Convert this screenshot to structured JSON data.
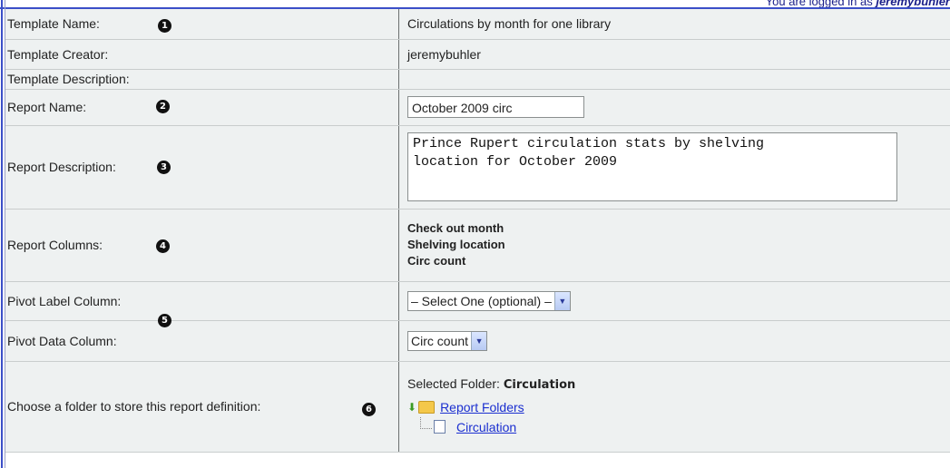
{
  "logged_in": {
    "prefix": "You are logged in as ",
    "user": "jeremybuhler"
  },
  "rows": {
    "template_name": {
      "label": "Template Name:",
      "value": "Circulations by month for one library",
      "bullet": "1"
    },
    "template_creator": {
      "label": "Template Creator:",
      "value": "jeremybuhler"
    },
    "template_description": {
      "label": "Template Description:",
      "value": ""
    },
    "report_name": {
      "label": "Report Name:",
      "value": "October 2009 circ",
      "bullet": "2"
    },
    "report_description": {
      "label": "Report Description:",
      "value": "Prince Rupert circulation stats by shelving\nlocation for October 2009",
      "bullet": "3"
    },
    "report_columns": {
      "label": "Report Columns:",
      "values": [
        "Check out month",
        "Shelving location",
        "Circ count"
      ],
      "bullet": "4"
    },
    "pivot_label": {
      "label": "Pivot Label Column:",
      "selected": "– Select One (optional) –"
    },
    "pivot_data": {
      "label": "Pivot Data Column:",
      "selected": "Circ count",
      "bullet": "5"
    },
    "folder": {
      "label": "Choose a folder to store this report definition:",
      "bullet": "6",
      "selected_prefix": "Selected Folder: ",
      "selected_name": "Circulation",
      "tree_root": "Report Folders",
      "tree_child": "Circulation"
    }
  },
  "icons": {
    "arrow": "green-down-arrow-icon",
    "folder": "folder-icon",
    "doc": "document-icon"
  }
}
